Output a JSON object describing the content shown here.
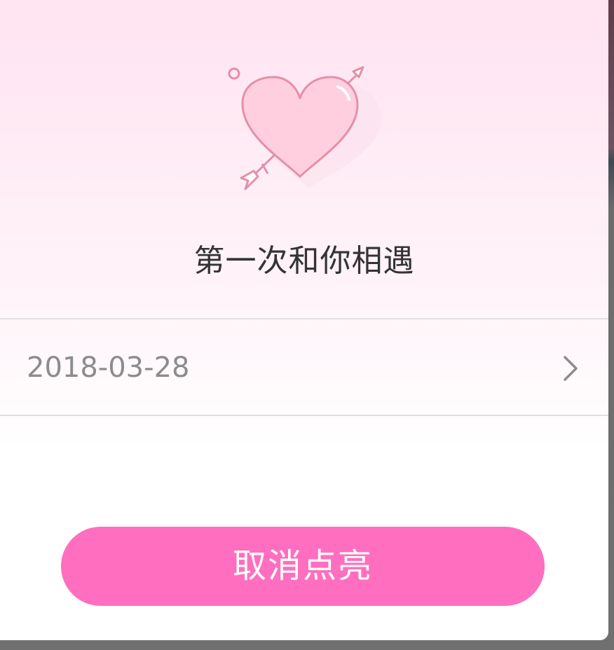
{
  "dialog": {
    "title": "第一次和你相遇",
    "date_value": "2018-03-28",
    "cancel_label": "取消点亮",
    "icons": {
      "heart": "heart-with-arrow-icon",
      "chevron": "chevron-right-icon"
    }
  },
  "colors": {
    "button": "#ff6ebf",
    "heart_fill": "#ffcfdf",
    "heart_stroke": "#e58fa8"
  }
}
